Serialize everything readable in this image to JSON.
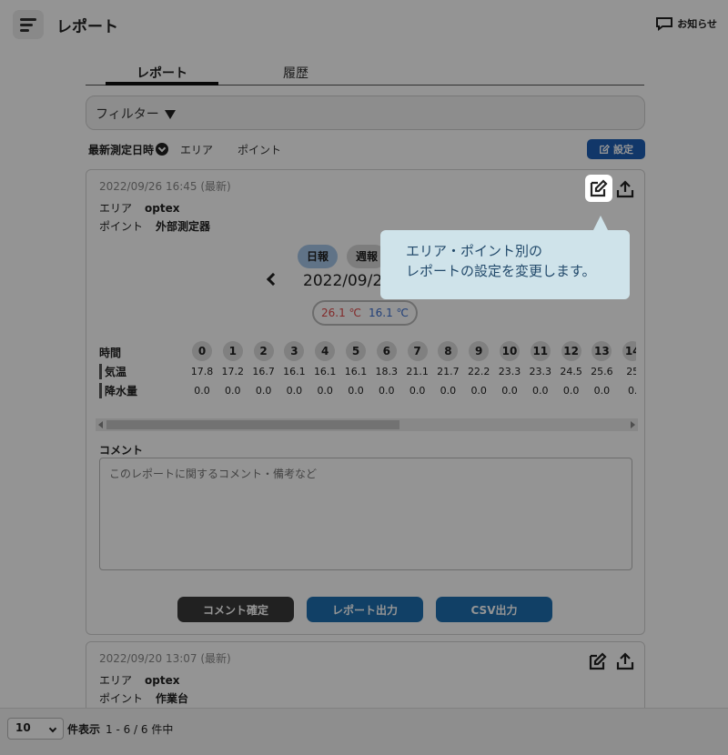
{
  "header": {
    "title": "レポート",
    "notice_label": "お知らせ"
  },
  "tabs": [
    {
      "label": "レポート"
    },
    {
      "label": "履歴"
    }
  ],
  "filter": {
    "label": "フィルター"
  },
  "sortbar": {
    "date": "最新測定日時",
    "area": "エリア",
    "point": "ポイント",
    "settings_label": "設定"
  },
  "cards": [
    {
      "date": "2022/09/26 16:45 (最新)",
      "area_label": "エリア",
      "area_value": "optex",
      "point_label": "ポイント",
      "point_value": "外部測定器",
      "period_tabs": [
        "日報",
        "週報"
      ],
      "date_nav": "2022/09/2",
      "temp_high": "26.1 ℃",
      "temp_low": "16.1 ℃",
      "table": {
        "hour_label": "時間",
        "temp_label": "気温",
        "rain_label": "降水量",
        "hours": [
          "0",
          "1",
          "2",
          "3",
          "4",
          "5",
          "6",
          "7",
          "8",
          "9",
          "10",
          "11",
          "12",
          "13",
          "14"
        ],
        "temps": [
          "17.8",
          "17.2",
          "16.7",
          "16.1",
          "16.1",
          "16.1",
          "18.3",
          "21.1",
          "21.7",
          "22.2",
          "23.3",
          "23.3",
          "24.5",
          "25.6",
          "25"
        ],
        "rain": [
          "0.0",
          "0.0",
          "0.0",
          "0.0",
          "0.0",
          "0.0",
          "0.0",
          "0.0",
          "0.0",
          "0.0",
          "0.0",
          "0.0",
          "0.0",
          "0.0",
          "0."
        ]
      },
      "comment_label": "コメント",
      "comment_placeholder": "このレポートに関するコメント・備考など",
      "buttons": {
        "confirm": "コメント確定",
        "export": "レポート出力",
        "csv": "CSV出力"
      }
    },
    {
      "date": "2022/09/20 13:07 (最新)",
      "area_label": "エリア",
      "area_value": "optex",
      "point_label": "ポイント",
      "point_value": "作業台"
    }
  ],
  "footer": {
    "per_page": "10",
    "per_page_label": "件表示",
    "range": "1 - 6 / 6 件中"
  },
  "tooltip": {
    "line1": "エリア・ポイント別の",
    "line2": "レポートの設定を変更します。"
  },
  "colors": {
    "accent": "#1e5fb6",
    "temp_high": "#e04a4a",
    "temp_low": "#3b6fd0",
    "tooltip_bg": "#cfe3ea"
  }
}
